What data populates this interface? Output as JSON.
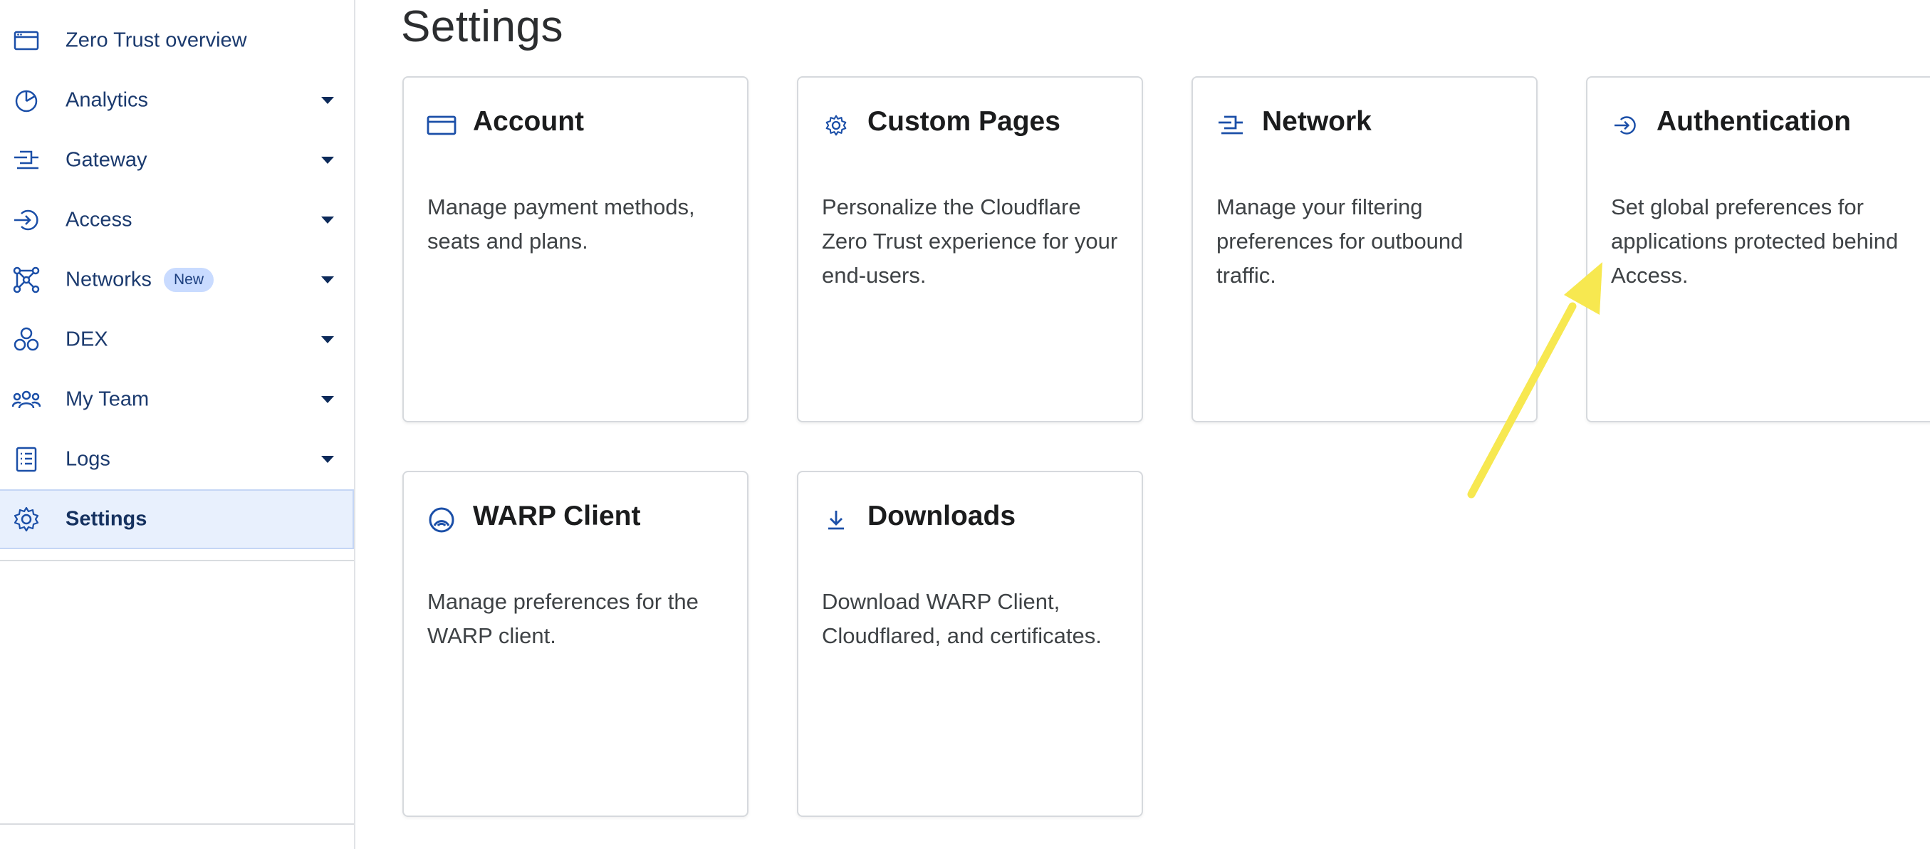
{
  "sidebar": {
    "items": [
      {
        "label": "Zero Trust overview",
        "icon": "browser-window-icon",
        "has_caret": false
      },
      {
        "label": "Analytics",
        "icon": "pie-chart-icon",
        "has_caret": true
      },
      {
        "label": "Gateway",
        "icon": "gateway-icon",
        "has_caret": true
      },
      {
        "label": "Access",
        "icon": "access-icon",
        "has_caret": true
      },
      {
        "label": "Networks",
        "icon": "network-nodes-icon",
        "has_caret": true,
        "badge": "New"
      },
      {
        "label": "DEX",
        "icon": "dex-icon",
        "has_caret": true
      },
      {
        "label": "My Team",
        "icon": "team-icon",
        "has_caret": true
      },
      {
        "label": "Logs",
        "icon": "logs-icon",
        "has_caret": true
      },
      {
        "label": "Settings",
        "icon": "gear-icon",
        "has_caret": false,
        "active": true
      }
    ]
  },
  "main": {
    "title": "Settings",
    "cards": [
      {
        "title": "Account",
        "icon": "credit-card-icon",
        "description": "Manage payment methods, seats and plans."
      },
      {
        "title": "Custom Pages",
        "icon": "gear-icon",
        "description": "Personalize the Cloudflare Zero Trust experience for your end-users."
      },
      {
        "title": "Network",
        "icon": "gateway-icon",
        "description": "Manage your filtering preferences for outbound traffic."
      },
      {
        "title": "Authentication",
        "icon": "access-icon",
        "description": "Set global preferences for applications protected behind Access."
      },
      {
        "title": "WARP Client",
        "icon": "warp-icon",
        "description": "Manage preferences for the WARP client."
      },
      {
        "title": "Downloads",
        "icon": "download-icon",
        "description": "Download WARP Client, Cloudflared, and certificates."
      }
    ]
  },
  "colors": {
    "accent": "#1b4fa8",
    "nav_text": "#1b3a6e",
    "active_bg": "#e8f0fd",
    "badge_bg": "#c9dbff",
    "annotation_arrow": "#f7e850"
  }
}
